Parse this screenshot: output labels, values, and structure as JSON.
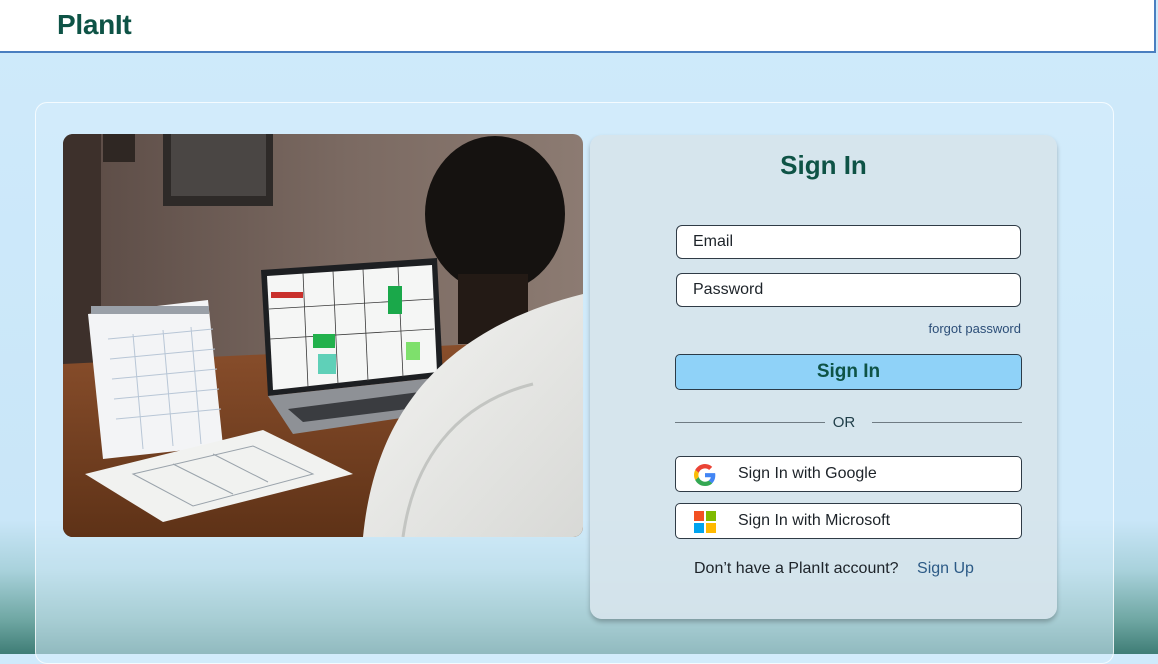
{
  "header": {
    "brand": "PlanIt"
  },
  "signin": {
    "title": "Sign In",
    "email_placeholder": "Email",
    "password_placeholder": "Password",
    "forgot_label": "forgot password",
    "submit_label": "Sign In",
    "divider_label": "OR",
    "google_label": "Sign In with Google",
    "microsoft_label": "Sign In with Microsoft",
    "signup_prompt": "Don’t have a PlanIt account?",
    "signup_link": "Sign Up"
  },
  "colors": {
    "brand": "#0e5346",
    "primary_button": "#8fd2f8",
    "link": "#2c5a86",
    "background": "#cfeafb"
  },
  "icons": {
    "google": "google-icon",
    "microsoft": "microsoft-icon"
  }
}
